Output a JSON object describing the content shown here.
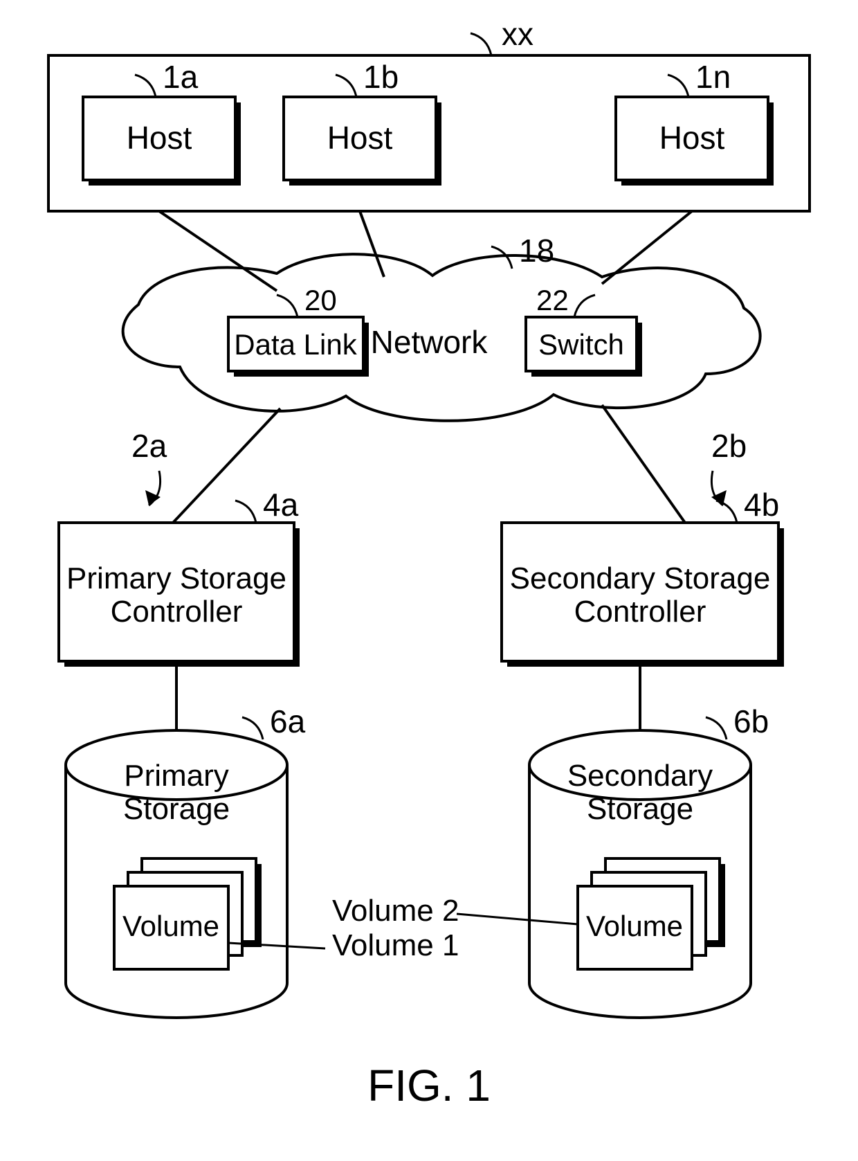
{
  "figure_label": "FIG. 1",
  "hosts_container_ref": "xx",
  "hosts": [
    {
      "ref": "1a",
      "label": "Host"
    },
    {
      "ref": "1b",
      "label": "Host"
    },
    {
      "ref": "1n",
      "label": "Host"
    }
  ],
  "network": {
    "ref": "18",
    "label": "Network",
    "datalink_ref": "20",
    "datalink_label": "Data Link",
    "switch_ref": "22",
    "switch_label": "Switch"
  },
  "paths": {
    "left": "2a",
    "right": "2b"
  },
  "primary": {
    "controller_ref": "4a",
    "controller_label_1": "Primary Storage",
    "controller_label_2": "Controller",
    "storage_ref": "6a",
    "storage_label_1": "Primary",
    "storage_label_2": "Storage",
    "volume_label": "Volume"
  },
  "secondary": {
    "controller_ref": "4b",
    "controller_label_1": "Secondary Storage",
    "controller_label_2": "Controller",
    "storage_ref": "6b",
    "storage_label_1": "Secondary",
    "storage_label_2": "Storage",
    "volume_label": "Volume"
  },
  "volume_callouts": {
    "top": "Volume 2",
    "bottom": "Volume 1"
  }
}
